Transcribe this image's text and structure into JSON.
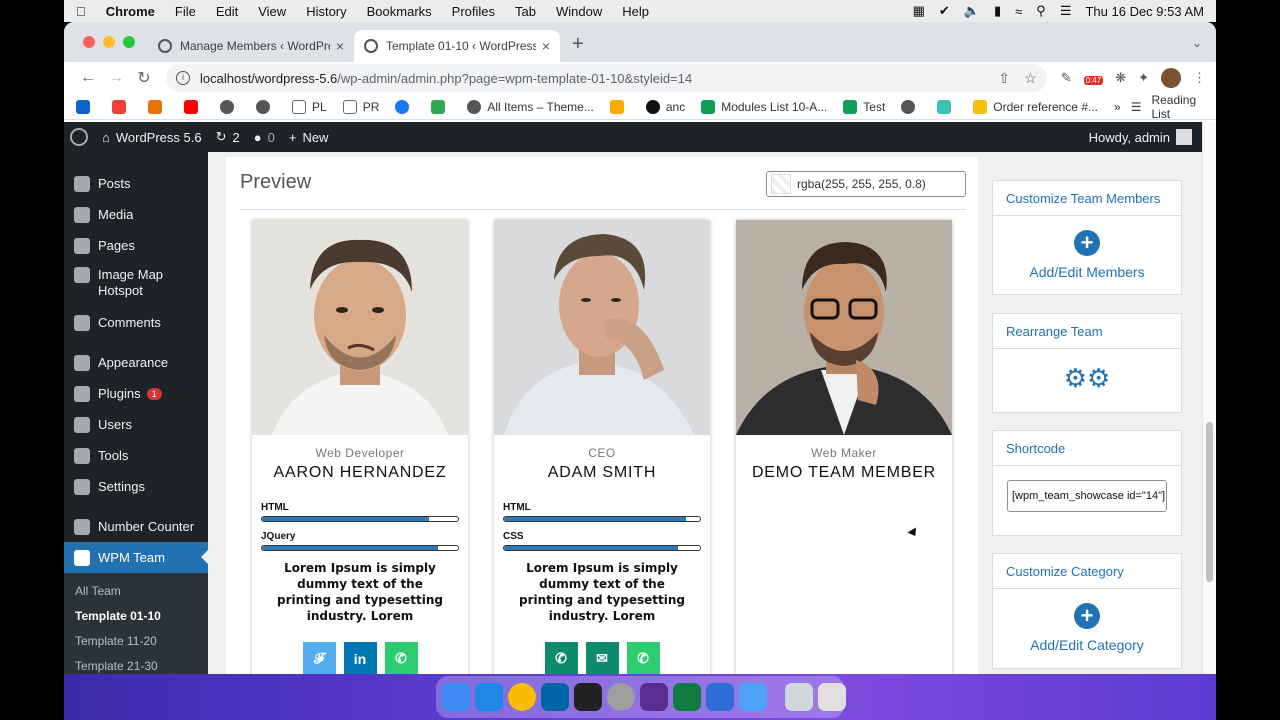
{
  "menubar": {
    "items": [
      "Chrome",
      "File",
      "Edit",
      "View",
      "History",
      "Bookmarks",
      "Profiles",
      "Tab",
      "Window",
      "Help"
    ],
    "datetime": "Thu 16 Dec  9:53 AM"
  },
  "tabs": [
    {
      "title": "Manage Members ‹ WordPress 5.6",
      "active": false
    },
    {
      "title": "Template 01-10 ‹ WordPress 5.6",
      "active": true
    }
  ],
  "url": {
    "host": "localhost",
    "path": "/wp-admin/admin.php?page=wpm-template-01-10&styleid=14",
    "prefix": "localhost/wordpress-5.6"
  },
  "extension_badge": "0:47",
  "bookmarks": [
    "PL",
    "PR",
    "All Items – Theme...",
    "anc",
    "Modules List 10-A...",
    "Test",
    "Order reference #..."
  ],
  "reading_list": "Reading List",
  "wpbar": {
    "site": "WordPress 5.6",
    "updates": "2",
    "comments": "0",
    "new": "New",
    "howdy": "Howdy, admin"
  },
  "sidebar": {
    "items": [
      "Posts",
      "Media",
      "Pages",
      "Image Map Hotspot",
      "Comments",
      "Appearance",
      "Plugins",
      "Users",
      "Tools",
      "Settings",
      "Number Counter",
      "WPM Team"
    ],
    "plugins_badge": "1",
    "submenu": [
      "All Team",
      "Template 01-10",
      "Template 11-20",
      "Template 21-30"
    ]
  },
  "preview": {
    "title": "Preview",
    "color_value": "rgba(255, 255, 255, 0.8)"
  },
  "cards": [
    {
      "designation": "Web Developer",
      "name": "AARON HERNANDEZ",
      "skills": [
        {
          "label": "HTML",
          "value": 85
        },
        {
          "label": "JQuery",
          "value": 90
        }
      ],
      "desc": "Lorem Ipsum is simply dummy text of the printing and typesetting industry. Lorem"
    },
    {
      "designation": "CEO",
      "name": "ADAM SMITH",
      "skills": [
        {
          "label": "HTML",
          "value": 93
        },
        {
          "label": "CSS",
          "value": 89
        }
      ],
      "desc": "Lorem Ipsum is simply dummy text of the printing and typesetting industry. Lorem"
    },
    {
      "designation": "Web Maker",
      "name": "DEMO TEAM MEMBER"
    }
  ],
  "right_panel": {
    "customize_members_title": "Customize Team Members",
    "add_edit_members": "Add/Edit Members",
    "rearrange_title": "Rearrange Team",
    "shortcode_title": "Shortcode",
    "shortcode_value": "[wpm_team_showcase id=\"14\"]",
    "customize_category_title": "Customize Category",
    "add_edit_category": "Add/Edit Category"
  },
  "colors": {
    "wp_blue": "#2271b1",
    "wp_dark": "#1d2327",
    "twitter": "#55acee",
    "linkedin": "#0077b5",
    "whatsapp": "#2ecc71",
    "phone": "#0e8a6c",
    "email": "#0e8a6c"
  }
}
